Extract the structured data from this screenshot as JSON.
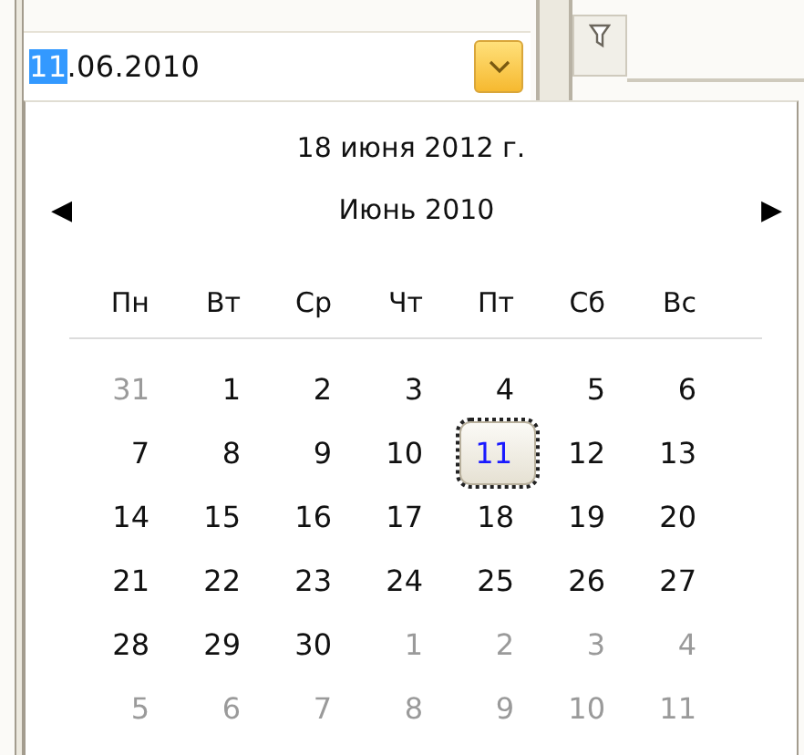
{
  "date_field": {
    "value_parts": [
      {
        "text": "11",
        "selected": true
      },
      {
        "text": ".06.2010",
        "selected": false
      }
    ]
  },
  "calendar": {
    "today": "18 июня 2012 г.",
    "prev": "◀",
    "month": "Июнь 2010",
    "next": "▶",
    "weekdays": [
      "Пн",
      "Вт",
      "Ср",
      "Чт",
      "Пт",
      "Сб",
      "Вс"
    ],
    "weeks": [
      [
        {
          "label": "31",
          "muted": true,
          "selected": false
        },
        {
          "label": "1",
          "muted": false,
          "selected": false
        },
        {
          "label": "2",
          "muted": false,
          "selected": false
        },
        {
          "label": "3",
          "muted": false,
          "selected": false
        },
        {
          "label": "4",
          "muted": false,
          "selected": false
        },
        {
          "label": "5",
          "muted": false,
          "selected": false
        },
        {
          "label": "6",
          "muted": false,
          "selected": false
        }
      ],
      [
        {
          "label": "7",
          "muted": false,
          "selected": false
        },
        {
          "label": "8",
          "muted": false,
          "selected": false
        },
        {
          "label": "9",
          "muted": false,
          "selected": false
        },
        {
          "label": "10",
          "muted": false,
          "selected": false
        },
        {
          "label": "11",
          "muted": false,
          "selected": true
        },
        {
          "label": "12",
          "muted": false,
          "selected": false
        },
        {
          "label": "13",
          "muted": false,
          "selected": false
        }
      ],
      [
        {
          "label": "14",
          "muted": false,
          "selected": false
        },
        {
          "label": "15",
          "muted": false,
          "selected": false
        },
        {
          "label": "16",
          "muted": false,
          "selected": false
        },
        {
          "label": "17",
          "muted": false,
          "selected": false
        },
        {
          "label": "18",
          "muted": false,
          "selected": false
        },
        {
          "label": "19",
          "muted": false,
          "selected": false
        },
        {
          "label": "20",
          "muted": false,
          "selected": false
        }
      ],
      [
        {
          "label": "21",
          "muted": false,
          "selected": false
        },
        {
          "label": "22",
          "muted": false,
          "selected": false
        },
        {
          "label": "23",
          "muted": false,
          "selected": false
        },
        {
          "label": "24",
          "muted": false,
          "selected": false
        },
        {
          "label": "25",
          "muted": false,
          "selected": false
        },
        {
          "label": "26",
          "muted": false,
          "selected": false
        },
        {
          "label": "27",
          "muted": false,
          "selected": false
        }
      ],
      [
        {
          "label": "28",
          "muted": false,
          "selected": false
        },
        {
          "label": "29",
          "muted": false,
          "selected": false
        },
        {
          "label": "30",
          "muted": false,
          "selected": false
        },
        {
          "label": "1",
          "muted": true,
          "selected": false
        },
        {
          "label": "2",
          "muted": true,
          "selected": false
        },
        {
          "label": "3",
          "muted": true,
          "selected": false
        },
        {
          "label": "4",
          "muted": true,
          "selected": false
        }
      ],
      [
        {
          "label": "5",
          "muted": true,
          "selected": false
        },
        {
          "label": "6",
          "muted": true,
          "selected": false
        },
        {
          "label": "7",
          "muted": true,
          "selected": false
        },
        {
          "label": "8",
          "muted": true,
          "selected": false
        },
        {
          "label": "9",
          "muted": true,
          "selected": false
        },
        {
          "label": "10",
          "muted": true,
          "selected": false
        },
        {
          "label": "11",
          "muted": true,
          "selected": false
        }
      ]
    ]
  }
}
